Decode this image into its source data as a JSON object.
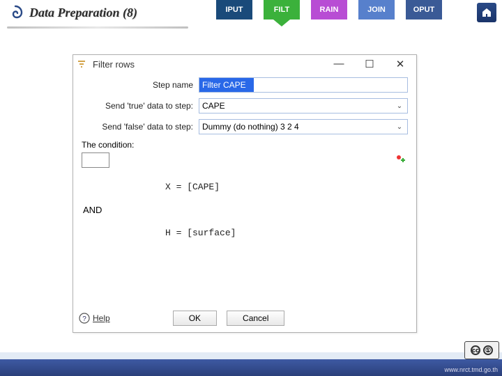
{
  "tabs": {
    "iput": "IPUT",
    "filt": "FILT",
    "rain": "RAIN",
    "join": "JOIN",
    "oput": "OPUT"
  },
  "page": {
    "title": "Data Preparation (8)"
  },
  "dialog": {
    "title": "Filter rows",
    "labels": {
      "step_name": "Step name",
      "send_true": "Send 'true' data to step:",
      "send_false": "Send 'false' data to step:",
      "condition": "The condition:"
    },
    "step_name_value": "Filter CAPE",
    "true_target": "CAPE",
    "false_target": "Dummy (do nothing) 3 2 4",
    "expressions": {
      "e1": "X  =  [CAPE]",
      "and": "AND",
      "e2": "H  =  [surface]"
    },
    "buttons": {
      "help": "Help",
      "ok": "OK",
      "cancel": "Cancel"
    }
  },
  "footer": {
    "url": "www.nrct.tmd.go.th"
  }
}
